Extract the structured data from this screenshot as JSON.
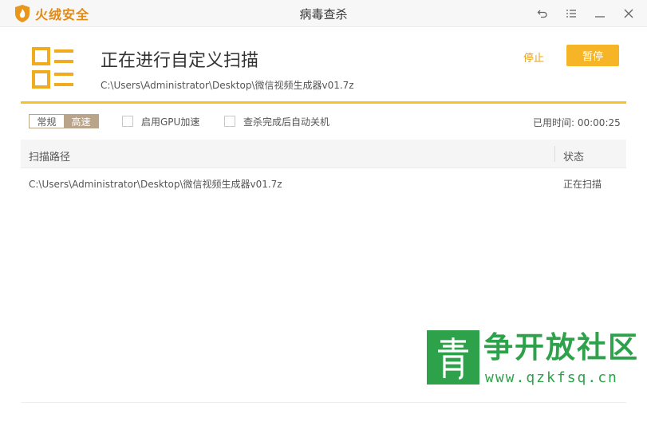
{
  "app": {
    "brand_name": "火绒安全",
    "window_title": "病毒查杀"
  },
  "window_controls": {
    "back_icon": "undo-arrow-icon",
    "menu_icon": "menu-lines-icon",
    "minimize_icon": "minimize-icon",
    "close_icon": "close-icon"
  },
  "scan": {
    "title": "正在进行自定义扫描",
    "current_path": "C:\\Users\\Administrator\\Desktop\\微信视频生成器v01.7z",
    "stop_label": "停止",
    "pause_label": "暂停"
  },
  "options": {
    "mode_normal": "常规",
    "mode_fast": "高速",
    "gpu_label": "启用GPU加速",
    "shutdown_label": "查杀完成后自动关机",
    "elapsed_label": "已用时间: 00:00:25"
  },
  "table": {
    "headers": [
      "扫描路径",
      "状态"
    ],
    "rows": [
      {
        "path": "C:\\Users\\Administrator\\Desktop\\微信视频生成器v01.7z",
        "status": "正在扫描"
      }
    ]
  },
  "watermark": {
    "title": "争开放社区",
    "url": "www.qzkfsq.cn"
  },
  "colors": {
    "brand": "#e28a16",
    "accent": "#f6b526",
    "divider": "#f4c22b",
    "watermark": "#2ea24a"
  }
}
